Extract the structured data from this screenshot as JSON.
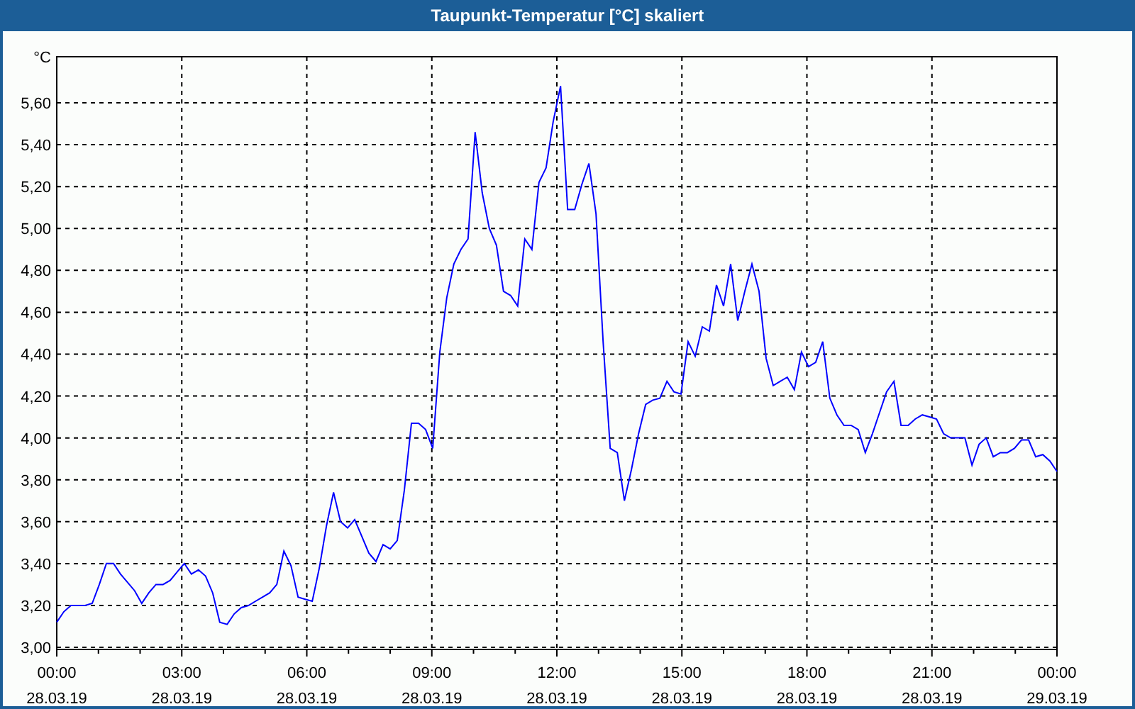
{
  "window": {
    "title": "Taupunkt-Temperatur [°C] skaliert"
  },
  "chart": {
    "chart_data": {
      "type": "line",
      "ylabel": "°C",
      "xlim": [
        0,
        24
      ],
      "ylim": [
        2.99,
        5.82
      ],
      "yticks": [
        {
          "value": 3.0,
          "label": "3,00"
        },
        {
          "value": 3.2,
          "label": "3,20"
        },
        {
          "value": 3.4,
          "label": "3,40"
        },
        {
          "value": 3.6,
          "label": "3,60"
        },
        {
          "value": 3.8,
          "label": "3,80"
        },
        {
          "value": 4.0,
          "label": "4,00"
        },
        {
          "value": 4.2,
          "label": "4,20"
        },
        {
          "value": 4.4,
          "label": "4,40"
        },
        {
          "value": 4.6,
          "label": "4,60"
        },
        {
          "value": 4.8,
          "label": "4,80"
        },
        {
          "value": 5.0,
          "label": "5,00"
        },
        {
          "value": 5.2,
          "label": "5,20"
        },
        {
          "value": 5.4,
          "label": "5,40"
        },
        {
          "value": 5.6,
          "label": "5,60"
        }
      ],
      "grid": true,
      "xticks": [
        {
          "value": 0,
          "label": "00:00"
        },
        {
          "value": 3,
          "label": "03:00"
        },
        {
          "value": 6,
          "label": "06:00"
        },
        {
          "value": 9,
          "label": "09:00"
        },
        {
          "value": 12,
          "label": "12:00"
        },
        {
          "value": 15,
          "label": "15:00"
        },
        {
          "value": 18,
          "label": "18:00"
        },
        {
          "value": 21,
          "label": "21:00"
        },
        {
          "value": 24,
          "label": "00:00"
        }
      ],
      "x": [
        0,
        0.17,
        0.34,
        0.51,
        0.68,
        0.85,
        1.02,
        1.19,
        1.36,
        1.53,
        1.7,
        1.87,
        2.04,
        2.21,
        2.38,
        2.55,
        2.72,
        2.89,
        3.06,
        3.23,
        3.4,
        3.57,
        3.74,
        3.91,
        4.09,
        4.26,
        4.43,
        4.6,
        4.77,
        4.94,
        5.11,
        5.28,
        5.45,
        5.62,
        5.79,
        5.96,
        6.13,
        6.3,
        6.47,
        6.64,
        6.81,
        6.98,
        7.15,
        7.32,
        7.49,
        7.66,
        7.83,
        8.0,
        8.17,
        8.34,
        8.51,
        8.68,
        8.85,
        9.02,
        9.19,
        9.36,
        9.53,
        9.7,
        9.87,
        10.04,
        10.21,
        10.38,
        10.55,
        10.72,
        10.89,
        11.06,
        11.23,
        11.4,
        11.57,
        11.74,
        11.91,
        12.09,
        12.26,
        12.43,
        12.6,
        12.77,
        12.94,
        13.11,
        13.28,
        13.45,
        13.62,
        13.79,
        13.96,
        14.13,
        14.3,
        14.47,
        14.64,
        14.81,
        14.98,
        15.15,
        15.32,
        15.49,
        15.66,
        15.83,
        16.0,
        16.17,
        16.34,
        16.51,
        16.68,
        16.85,
        17.02,
        17.19,
        17.36,
        17.53,
        17.7,
        17.87,
        18.04,
        18.21,
        18.38,
        18.55,
        18.72,
        18.89,
        19.06,
        19.23,
        19.4,
        19.57,
        19.74,
        19.91,
        20.09,
        20.26,
        20.43,
        20.6,
        20.77,
        20.94,
        21.11,
        21.28,
        21.45,
        21.62,
        21.79,
        21.96,
        22.13,
        22.3,
        22.47,
        22.64,
        22.81,
        22.98,
        23.15,
        23.32,
        23.49,
        23.66,
        23.83,
        24.0
      ],
      "series": [
        {
          "color": "#0000ff",
          "values": [
            3.12,
            3.17,
            3.2,
            3.2,
            3.2,
            3.21,
            3.3,
            3.4,
            3.4,
            3.35,
            3.31,
            3.27,
            3.21,
            3.26,
            3.3,
            3.3,
            3.32,
            3.36,
            3.4,
            3.35,
            3.37,
            3.34,
            3.26,
            3.12,
            3.11,
            3.16,
            3.19,
            3.2,
            3.22,
            3.24,
            3.26,
            3.3,
            3.46,
            3.39,
            3.24,
            3.23,
            3.22,
            3.38,
            3.58,
            3.74,
            3.6,
            3.57,
            3.61,
            3.53,
            3.45,
            3.41,
            3.49,
            3.47,
            3.51,
            3.75,
            4.07,
            4.07,
            4.04,
            3.95,
            4.41,
            4.67,
            4.83,
            4.9,
            4.95,
            5.46,
            5.17,
            5.0,
            4.92,
            4.7,
            4.68,
            4.63,
            4.95,
            4.9,
            5.22,
            5.29,
            5.51,
            5.68,
            5.09,
            5.09,
            5.21,
            5.31,
            5.07,
            4.46,
            3.95,
            3.93,
            3.7,
            3.85,
            4.02,
            4.16,
            4.18,
            4.19,
            4.27,
            4.22,
            4.21,
            4.46,
            4.39,
            4.53,
            4.51,
            4.73,
            4.63,
            4.83,
            4.56,
            4.7,
            4.83,
            4.7,
            4.38,
            4.25,
            4.27,
            4.29,
            4.23,
            4.41,
            4.34,
            4.36,
            4.46,
            4.19,
            4.11,
            4.06,
            4.06,
            4.04,
            3.93,
            4.02,
            4.12,
            4.22,
            4.27,
            4.06,
            4.06,
            4.09,
            4.11,
            4.1,
            4.09,
            4.02,
            4.0,
            4.0,
            4.0,
            3.87,
            3.97,
            4.0,
            3.91,
            3.93,
            3.93,
            3.95,
            3.99,
            3.99,
            3.91,
            3.92,
            3.89,
            3.84
          ]
        }
      ]
    },
    "x_tick_dates": [
      "28.03.19",
      "28.03.19",
      "28.03.19",
      "28.03.19",
      "28.03.19",
      "28.03.19",
      "28.03.19",
      "28.03.19",
      "29.03.19"
    ]
  }
}
